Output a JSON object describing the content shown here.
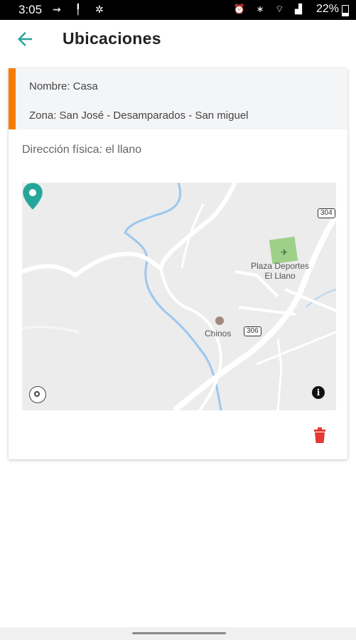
{
  "status": {
    "time": "3:05",
    "battery": "22%"
  },
  "header": {
    "title": "Ubicaciones"
  },
  "location": {
    "name": "Nombre: Casa",
    "zone": "Zona: San José - Desamparados - San miguel",
    "address": "Dirección física: el llano"
  },
  "map": {
    "poi_plaza": "Plaza Deportes\nEl Llano",
    "poi_chinos": "Chinos",
    "road_306": "306",
    "road_304": "304"
  },
  "colors": {
    "accent": "#f57c00",
    "pin": "#26a69a",
    "delete": "#e53935"
  }
}
